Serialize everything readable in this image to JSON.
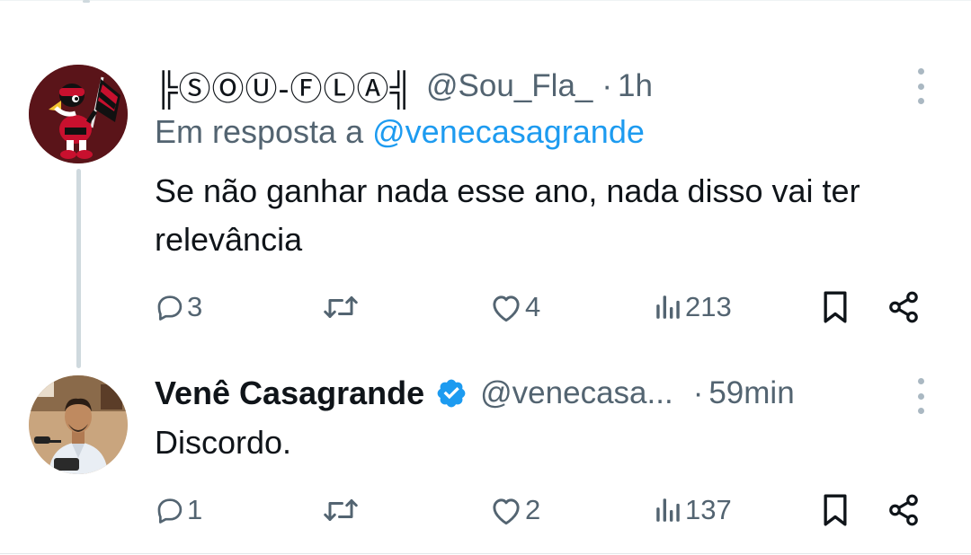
{
  "tweets": [
    {
      "display_name": "╠ⓈⓄⓊ-ⒻⓁⒶ╣",
      "handle": "@Sou_Fla_",
      "separator": "·",
      "time": "1h",
      "reply_prefix": "Em resposta a",
      "reply_mention": "@venecasagrande",
      "text": "Se não ganhar nada esse ano, nada disso vai ter relevância",
      "replies": "3",
      "likes": "4",
      "views": "213"
    },
    {
      "display_name": "Venê Casagrande",
      "verified": true,
      "handle": "@venecasa...",
      "separator": "·",
      "time": "59min",
      "text": "Discordo.",
      "replies": "1",
      "likes": "2",
      "views": "137"
    }
  ],
  "colors": {
    "text_primary": "#0f1419",
    "text_secondary": "#536471",
    "link": "#1d9bf0",
    "verified": "#1d9bf0",
    "thread_line": "#cfd9de"
  },
  "icons": [
    "reply-icon",
    "retweet-icon",
    "like-icon",
    "views-icon",
    "bookmark-icon",
    "share-icon",
    "more-icon",
    "verified-badge-icon"
  ]
}
